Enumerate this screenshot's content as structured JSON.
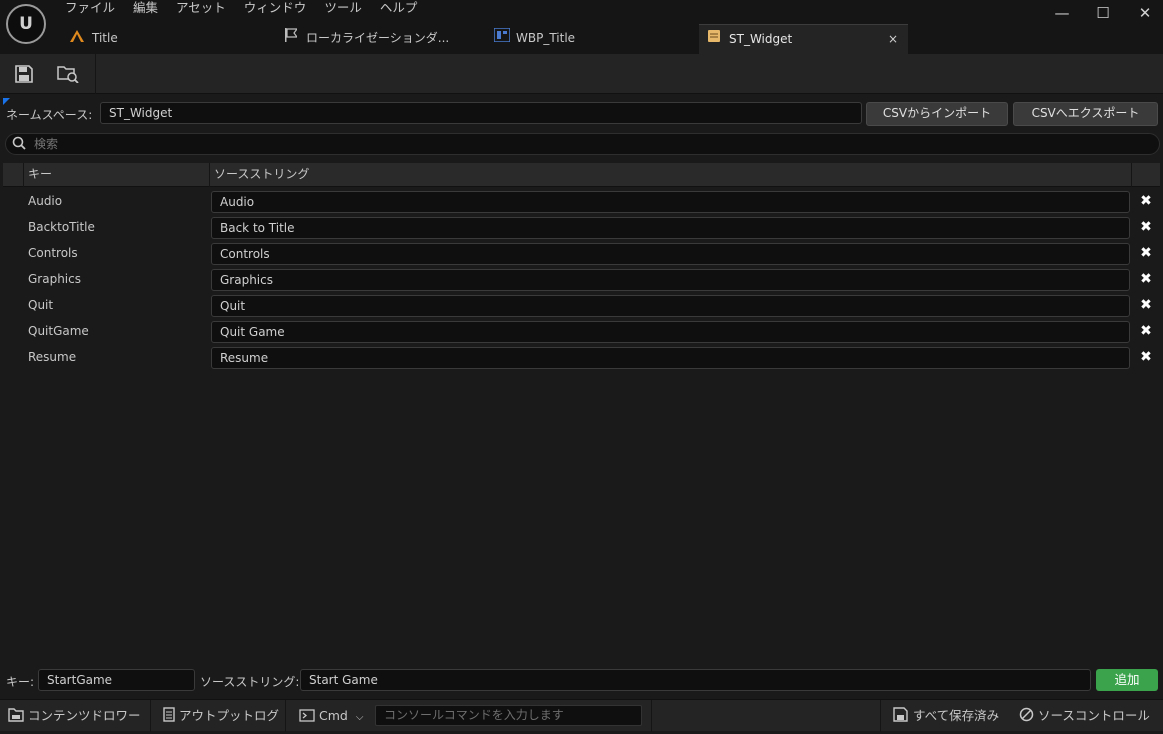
{
  "menu": [
    "ファイル",
    "編集",
    "アセット",
    "ウィンドウ",
    "ツール",
    "ヘルプ"
  ],
  "window_controls": {
    "minimize": "—",
    "maximize": "☐",
    "close": "✕"
  },
  "tabs": [
    {
      "label": "Title",
      "icon": "level-icon"
    },
    {
      "label": "ローカライゼーションダ...",
      "icon": "flag-icon"
    },
    {
      "label": "WBP_Title",
      "icon": "widget-blueprint-icon"
    },
    {
      "label": "ST_Widget",
      "icon": "string-table-icon",
      "close": "×"
    }
  ],
  "toolbar": {
    "save_icon": "save-icon",
    "browse_icon": "browse-icon"
  },
  "namespace": {
    "label": "ネームスペース:",
    "value": "ST_Widget",
    "import_label": "CSVからインポート",
    "export_label": "CSVへエクスポート"
  },
  "search": {
    "placeholder": "検索"
  },
  "table": {
    "col_key": "キー",
    "col_source": "ソースストリング",
    "rows": [
      {
        "key": "Audio",
        "source": "Audio"
      },
      {
        "key": "BacktoTitle",
        "source": "Back to Title"
      },
      {
        "key": "Controls",
        "source": "Controls"
      },
      {
        "key": "Graphics",
        "source": "Graphics"
      },
      {
        "key": "Quit",
        "source": "Quit"
      },
      {
        "key": "QuitGame",
        "source": "Quit Game"
      },
      {
        "key": "Resume",
        "source": "Resume"
      }
    ],
    "delete_glyph": "✖"
  },
  "add_entry": {
    "key_label": "キー:",
    "key_value": "StartGame",
    "source_label": "ソースストリング:",
    "source_value": "Start Game",
    "add_label": "追加"
  },
  "statusbar": {
    "content_drawer": "コンテンツドロワー",
    "output_log": "アウトプットログ",
    "cmd_label": "Cmd",
    "cmd_placeholder": "コンソールコマンドを入力します",
    "all_saved": "すべて保存済み",
    "source_control": "ソースコントロール"
  },
  "colors": {
    "accent_green": "#3ba34c",
    "background": "#1a1a1a",
    "panel": "#242424"
  }
}
